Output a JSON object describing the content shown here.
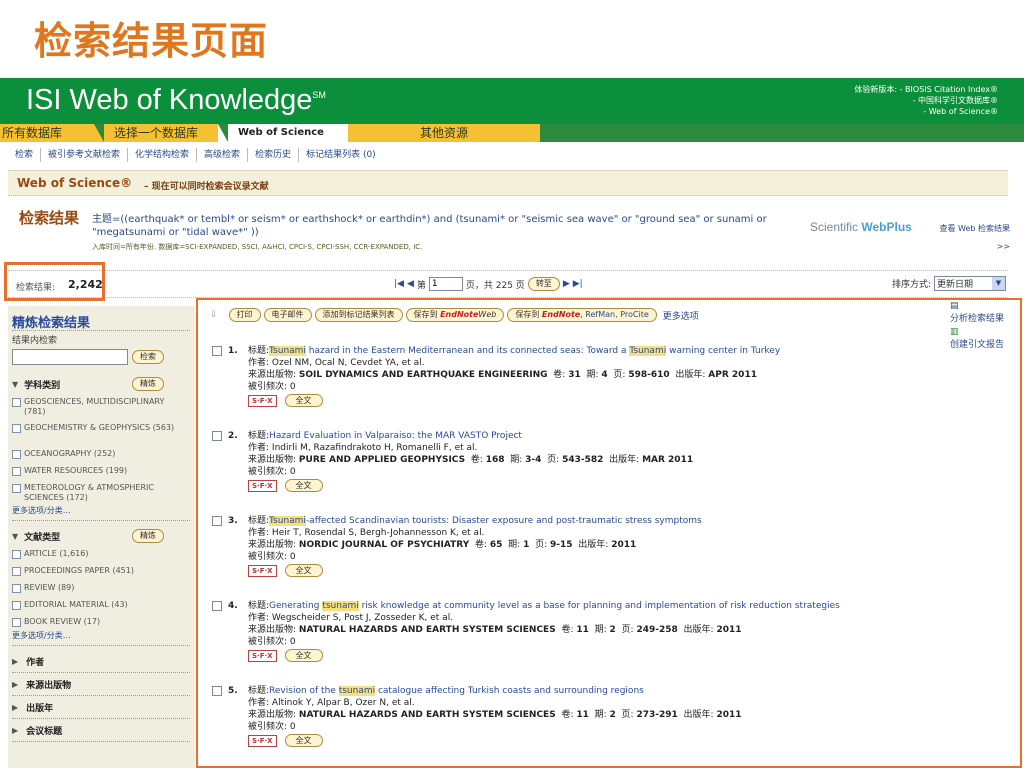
{
  "slide_title": "检索结果页面",
  "banner": {
    "logo": "ISI Web of Knowledge",
    "logo_mark": "SM",
    "notes": [
      "体验新版本: - BIOSIS Citation Index®",
      "- 中国科学引文数据库®",
      "- Web of Science®"
    ]
  },
  "tabs": {
    "all": "所有数据库",
    "select": "选择一个数据库",
    "wos": "Web of Science",
    "other": "其他资源"
  },
  "subnav": [
    "检索",
    "被引参考文献检索",
    "化学结构检索",
    "高级检索",
    "检索历史",
    "标记结果列表 (0)"
  ],
  "wos_header": {
    "title": "Web of Science®",
    "subtitle": "– 现在可以同时检索会议录文献"
  },
  "query": {
    "label": "检索结果",
    "text": "主题=((earthquak* or tembl* or seism* or earthshock* or earthdin*) and (tsunami* or \"seismic sea wave\" or \"ground sea\" or sunami or \"megatsunami or \"tidal wave*\" ))",
    "meta": "入库时间=所有年份. 数据库=SCI-EXPANDED, SSCI, A&HCI, CPCI-S, CPCI-SSH, CCR-EXPANDED, IC.",
    "wp_brand_a": "Scientific",
    "wp_brand_b": "WebPlus",
    "wp_link": "查看 Web 检索结果 >>"
  },
  "count": {
    "label": "检索结果:",
    "value": "2,242"
  },
  "pager": {
    "prefix": "第",
    "page": "1",
    "suffix": "页，共 225 页",
    "go": "转至"
  },
  "sort": {
    "label": "排序方式:",
    "value": "更新日期"
  },
  "sidebar": {
    "title": "精炼检索结果",
    "within": "结果内检索",
    "search_btn": "检索",
    "refine_btn": "精炼",
    "subject_head": "学科类别",
    "subjects": [
      "GEOSCIENCES, MULTIDISCIPLINARY (781)",
      "GEOCHEMISTRY & GEOPHYSICS (563)",
      "OCEANOGRAPHY (252)",
      "WATER RESOURCES (199)",
      "METEOROLOGY & ATMOSPHERIC SCIENCES (172)"
    ],
    "more": "更多选项/分类…",
    "doctype_head": "文献类型",
    "doctypes": [
      "ARTICLE (1,616)",
      "PROCEEDINGS PAPER (451)",
      "REVIEW (89)",
      "EDITORIAL MATERIAL (43)",
      "BOOK REVIEW (17)"
    ],
    "collapsed": [
      "作者",
      "来源出版物",
      "出版年",
      "会议标题"
    ]
  },
  "toolbar": {
    "print": "打印",
    "email": "电子邮件",
    "add_marked": "添加到标记结果列表",
    "save_en_web_prefix": "保存到",
    "save_en_web_brand": "EndNote",
    "save_en_web_suffix": "Web",
    "save_local_prefix": "保存到",
    "save_local_brand": "EndNote",
    "save_local_suffix": ", RefMan, ProCite",
    "more": "更多选项",
    "analyze": "分析检索结果",
    "citation_report": "创建引文报告"
  },
  "labels": {
    "title": "标题:",
    "author": "作者:",
    "source": "来源出版物:",
    "vol": "卷:",
    "issue": "期:",
    "pages": "页:",
    "pubyear": "出版年:",
    "cited": "被引频次:",
    "sfx": "S·F·X",
    "fulltext": "全文"
  },
  "records": [
    {
      "num": "1.",
      "title_parts": [
        "",
        "Tsunami",
        " hazard in the Eastern Mediterranean and its connected seas: Toward a ",
        "Tsunami",
        " warning center in Turkey"
      ],
      "authors": "Ozel NM, Ocal N, Cevdet YA, et al.",
      "source": "SOIL DYNAMICS AND EARTHQUAKE ENGINEERING",
      "vol": "31",
      "issue": "4",
      "pages": "598-610",
      "year": "APR 2011",
      "cited": "0"
    },
    {
      "num": "2.",
      "title_parts": [
        "Hazard Evaluation in Valparaiso: the MAR VASTO Project"
      ],
      "authors": "Indirli M, Razafindrakoto H, Romanelli F, et al.",
      "source": "PURE AND APPLIED GEOPHYSICS",
      "vol": "168",
      "issue": "3-4",
      "pages": "543-582",
      "year": "MAR 2011",
      "cited": "0"
    },
    {
      "num": "3.",
      "title_parts": [
        "",
        "Tsunami",
        "-affected Scandinavian tourists: Disaster exposure and post-traumatic stress symptoms"
      ],
      "authors": "Heir T, Rosendal S, Bergh-Johannesson K, et al.",
      "source": "NORDIC JOURNAL OF PSYCHIATRY",
      "vol": "65",
      "issue": "1",
      "pages": "9-15",
      "year": "2011",
      "cited": "0"
    },
    {
      "num": "4.",
      "title_parts": [
        "Generating ",
        "tsunami",
        " risk knowledge at community level as a base for planning and implementation of risk reduction strategies"
      ],
      "authors": "Wegscheider S, Post J, Zosseder K, et al.",
      "source": "NATURAL HAZARDS AND EARTH SYSTEM SCIENCES",
      "vol": "11",
      "issue": "2",
      "pages": "249-258",
      "year": "2011",
      "cited": "0"
    },
    {
      "num": "5.",
      "title_parts": [
        "Revision of the ",
        "tsunami",
        " catalogue affecting Turkish coasts and surrounding regions"
      ],
      "authors": "Altinok Y, Alpar B, Ozer N, et al.",
      "source": "NATURAL HAZARDS AND EARTH SYSTEM SCIENCES",
      "vol": "11",
      "issue": "2",
      "pages": "273-291",
      "year": "2011",
      "cited": "0"
    }
  ]
}
